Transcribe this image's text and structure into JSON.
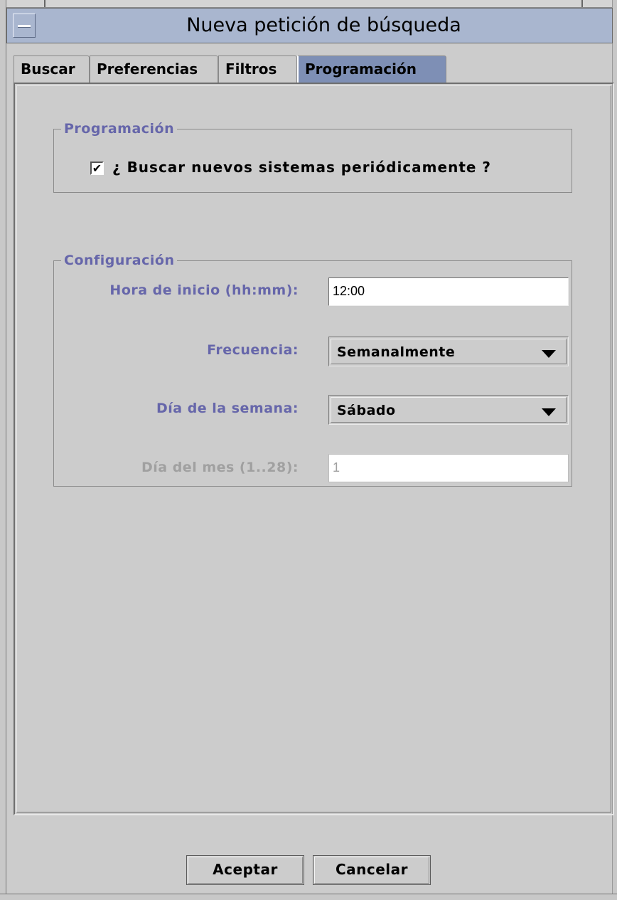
{
  "window": {
    "title": "Nueva petición de búsqueda"
  },
  "tabs": [
    {
      "label": "Buscar",
      "active": false
    },
    {
      "label": "Preferencias",
      "active": false
    },
    {
      "label": "Filtros",
      "active": false
    },
    {
      "label": "Programación",
      "active": true
    }
  ],
  "schedule_group": {
    "legend": "Programación",
    "periodic_checkbox": {
      "label": "¿ Buscar nuevos sistemas periódicamente ?",
      "checked": true,
      "mark": "✔"
    }
  },
  "config_group": {
    "legend": "Configuración",
    "start_time": {
      "label": "Hora de inicio (hh:mm):",
      "value": "12:00"
    },
    "frequency": {
      "label": "Frecuencia:",
      "selected": "Semanalmente"
    },
    "weekday": {
      "label": "Día de la semana:",
      "selected": "Sábado"
    },
    "month_day": {
      "label": "Día del mes (1..28):",
      "value": "1",
      "enabled": false
    }
  },
  "buttons": {
    "accept": "Aceptar",
    "cancel": "Cancelar"
  },
  "colors": {
    "title_bar": "#a9b6cf",
    "active_tab": "#7e8fb5",
    "label_text": "#6666aa",
    "disabled_text": "#a0a0a0",
    "background": "#cccccc"
  }
}
